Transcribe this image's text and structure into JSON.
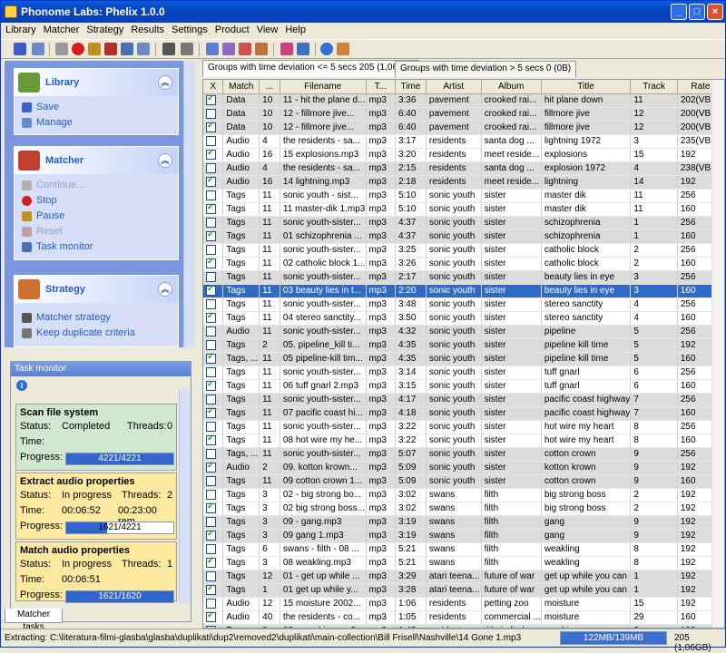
{
  "window": {
    "title": "Phonome Labs: Phelix 1.0.0",
    "minimize": "_",
    "maximize": "□",
    "close": "×"
  },
  "menu": [
    "Library",
    "Matcher",
    "Strategy",
    "Results",
    "Settings",
    "Product",
    "View",
    "Help"
  ],
  "sidebar": {
    "library": {
      "title": "Library",
      "items": [
        "Save",
        "Manage"
      ]
    },
    "matcher": {
      "title": "Matcher",
      "items": [
        "Continue...",
        "Stop",
        "Pause",
        "Reset",
        "Task monitor"
      ]
    },
    "strategy": {
      "title": "Strategy",
      "items": [
        "Matcher strategy",
        "Keep duplicate criteria"
      ]
    }
  },
  "taskmonitor": {
    "title": "Task monitor",
    "tasks": [
      {
        "name": "Scan file system",
        "status_label": "Status:",
        "status": "Completed",
        "threads_label": "Threads:",
        "threads": "0",
        "time_label": "Time:",
        "time": "",
        "eta": "",
        "progress_label": "Progress:",
        "progress": "4221/4221",
        "fraction": 1.0,
        "color": "#cfe8cf"
      },
      {
        "name": "Extract audio properties",
        "status_label": "Status:",
        "status": "In progress",
        "threads_label": "Threads:",
        "threads": "2",
        "time_label": "Time:",
        "time": "00:06:52",
        "eta": "00:23:00 rem",
        "progress_label": "Progress:",
        "progress": "1621/4221",
        "fraction": 0.38,
        "color": "#fde9a0"
      },
      {
        "name": "Match audio properties",
        "status_label": "Status:",
        "status": "In progress",
        "threads_label": "Threads:",
        "threads": "1",
        "time_label": "Time:",
        "time": "00:06:51",
        "eta": "",
        "progress_label": "Progress:",
        "progress": "1621/1620",
        "fraction": 1.0,
        "color": "#fde9a0"
      }
    ],
    "tab": "Matcher tasks"
  },
  "tabs": [
    "Groups with time deviation <= 5 secs 205 (1,06GB)",
    "Groups with time deviation > 5 secs  0 (0B)"
  ],
  "columns": [
    "X",
    "Match",
    "...",
    "Filename",
    "T...",
    "Time",
    "Artist",
    "Album",
    "Title",
    "Track",
    "Rate"
  ],
  "rows": [
    [
      1,
      "Data",
      "10",
      "11 - hit the plane d...",
      "mp3",
      "3:36",
      "pavement",
      "crooked rai...",
      "hit plane down",
      "11",
      "202(VBR)",
      "g"
    ],
    [
      0,
      "Data",
      "10",
      "12 - fillmore jive...",
      "mp3",
      "6:40",
      "pavement",
      "crooked rai...",
      "fillmore jive",
      "12",
      "200(VBR)",
      "g"
    ],
    [
      1,
      "Data",
      "10",
      "12 - fillmore jive...",
      "mp3",
      "6:40",
      "pavement",
      "crooked rai...",
      "fillmore jive",
      "12",
      "200(VBR)",
      "g"
    ],
    [
      0,
      "Audio",
      "4",
      "the residents - sa...",
      "mp3",
      "3:17",
      "residents",
      "santa dog ...",
      "lightning 1972",
      "3",
      "235(VBR)",
      "w"
    ],
    [
      1,
      "Audio",
      "16",
      "15 explosions.mp3",
      "mp3",
      "3:20",
      "residents",
      "meet reside...",
      "explosions",
      "15",
      "192",
      "w"
    ],
    [
      0,
      "Audio",
      "4",
      "the residents - sa...",
      "mp3",
      "2:15",
      "residents",
      "santa dog ...",
      "explosion 1972",
      "4",
      "238(VBR)",
      "g"
    ],
    [
      1,
      "Audio",
      "16",
      "14 lightning.mp3",
      "mp3",
      "2:18",
      "residents",
      "meet reside...",
      "lightning",
      "14",
      "192",
      "g"
    ],
    [
      0,
      "Tags",
      "11",
      "sonic youth - sist...",
      "mp3",
      "5:10",
      "sonic youth",
      "sister",
      "master dik",
      "11",
      "256",
      "w"
    ],
    [
      1,
      "Tags",
      "11",
      "11 master-dik 1.mp3",
      "mp3",
      "5:10",
      "sonic youth",
      "sister",
      "master dik",
      "11",
      "160",
      "w"
    ],
    [
      0,
      "Tags",
      "11",
      "sonic youth-sister...",
      "mp3",
      "4:37",
      "sonic youth",
      "sister",
      "schizophrenia",
      "1",
      "256",
      "g"
    ],
    [
      1,
      "Tags",
      "11",
      "01 schizophrenia ...",
      "mp3",
      "4:37",
      "sonic youth",
      "sister",
      "schizophrenia",
      "1",
      "160",
      "g"
    ],
    [
      0,
      "Tags",
      "11",
      "sonic youth-sister...",
      "mp3",
      "3:25",
      "sonic youth",
      "sister",
      "catholic block",
      "2",
      "256",
      "w"
    ],
    [
      1,
      "Tags",
      "11",
      "02 catholic block 1...",
      "mp3",
      "3:26",
      "sonic youth",
      "sister",
      "catholic block",
      "2",
      "160",
      "w"
    ],
    [
      0,
      "Tags",
      "11",
      "sonic youth-sister...",
      "mp3",
      "2:17",
      "sonic youth",
      "sister",
      "beauty lies in eye",
      "3",
      "256",
      "g"
    ],
    [
      1,
      "Tags",
      "11",
      "03 beauty lies in t...",
      "mp3",
      "2:20",
      "sonic youth",
      "sister",
      "beauty lies in eye",
      "3",
      "160",
      "sel"
    ],
    [
      0,
      "Tags",
      "11",
      "sonic youth-sister...",
      "mp3",
      "3:48",
      "sonic youth",
      "sister",
      "stereo sanctity",
      "4",
      "256",
      "w"
    ],
    [
      1,
      "Tags",
      "11",
      "04 stereo sanctity...",
      "mp3",
      "3:50",
      "sonic youth",
      "sister",
      "stereo sanctity",
      "4",
      "160",
      "w"
    ],
    [
      0,
      "Audio",
      "11",
      "sonic youth-sister...",
      "mp3",
      "4:32",
      "sonic youth",
      "sister",
      "pipeline",
      "5",
      "256",
      "g"
    ],
    [
      0,
      "Tags",
      "2",
      "05. pipeline_kill ti...",
      "mp3",
      "4:35",
      "sonic youth",
      "sister",
      "pipeline kill time",
      "5",
      "192",
      "g"
    ],
    [
      1,
      "Tags, ...",
      "11",
      "05 pipeline-kill tim...",
      "mp3",
      "4:35",
      "sonic youth",
      "sister",
      "pipeline kill time",
      "5",
      "160",
      "g"
    ],
    [
      0,
      "Tags",
      "11",
      "sonic youth-sister...",
      "mp3",
      "3:14",
      "sonic youth",
      "sister",
      "tuff gnarl",
      "6",
      "256",
      "w"
    ],
    [
      1,
      "Tags",
      "11",
      "06 tuff gnarl 2.mp3",
      "mp3",
      "3:15",
      "sonic youth",
      "sister",
      "tuff gnarl",
      "6",
      "160",
      "w"
    ],
    [
      0,
      "Tags",
      "11",
      "sonic youth-sister...",
      "mp3",
      "4:17",
      "sonic youth",
      "sister",
      "pacific coast highway",
      "7",
      "256",
      "g"
    ],
    [
      1,
      "Tags",
      "11",
      "07 pacific coast hi...",
      "mp3",
      "4:18",
      "sonic youth",
      "sister",
      "pacific coast highway",
      "7",
      "160",
      "g"
    ],
    [
      0,
      "Tags",
      "11",
      "sonic youth-sister...",
      "mp3",
      "3:22",
      "sonic youth",
      "sister",
      "hot wire my heart",
      "8",
      "256",
      "w"
    ],
    [
      1,
      "Tags",
      "11",
      "08 hot wire my he...",
      "mp3",
      "3:22",
      "sonic youth",
      "sister",
      "hot wire my heart",
      "8",
      "160",
      "w"
    ],
    [
      0,
      "Tags, ...",
      "11",
      "sonic youth-sister...",
      "mp3",
      "5:07",
      "sonic youth",
      "sister",
      "cotton crown",
      "9",
      "256",
      "g"
    ],
    [
      1,
      "Audio",
      "2",
      "09. kotton krown...",
      "mp3",
      "5:09",
      "sonic youth",
      "sister",
      "kotton krown",
      "9",
      "192",
      "g"
    ],
    [
      0,
      "Tags",
      "11",
      "09 cotton crown 1...",
      "mp3",
      "5:09",
      "sonic youth",
      "sister",
      "cotton crown",
      "9",
      "160",
      "g"
    ],
    [
      0,
      "Tags",
      "3",
      "02 - big strong bo...",
      "mp3",
      "3:02",
      "swans",
      "filth",
      "big strong boss",
      "2",
      "192",
      "w"
    ],
    [
      1,
      "Tags",
      "3",
      "02 big strong boss...",
      "mp3",
      "3:02",
      "swans",
      "filth",
      "big strong boss",
      "2",
      "192",
      "w"
    ],
    [
      0,
      "Tags",
      "3",
      "09 - gang.mp3",
      "mp3",
      "3:19",
      "swans",
      "filth",
      "gang",
      "9",
      "192",
      "g"
    ],
    [
      1,
      "Tags",
      "3",
      "09 gang 1.mp3",
      "mp3",
      "3:19",
      "swans",
      "filth",
      "gang",
      "9",
      "192",
      "g"
    ],
    [
      0,
      "Tags",
      "6",
      "swans - filth - 08 ...",
      "mp3",
      "5:21",
      "swans",
      "filth",
      "weakling",
      "8",
      "192",
      "w"
    ],
    [
      1,
      "Tags",
      "3",
      "08 weakling.mp3",
      "mp3",
      "5:21",
      "swans",
      "filth",
      "weakling",
      "8",
      "192",
      "w"
    ],
    [
      0,
      "Tags",
      "12",
      "01 - get up while ...",
      "mp3",
      "3:29",
      "atari teena...",
      "future of war",
      "get up while you can",
      "1",
      "192",
      "g"
    ],
    [
      1,
      "Tags",
      "1",
      "01 get up while y...",
      "mp3",
      "3:28",
      "atari teena...",
      "future of war",
      "get up while you can",
      "1",
      "192",
      "g"
    ],
    [
      0,
      "Audio",
      "12",
      "15 moisture 2002...",
      "mp3",
      "1:06",
      "residents",
      "petting zoo",
      "moisture",
      "15",
      "192",
      "w"
    ],
    [
      1,
      "Audio",
      "40",
      "the residents - co...",
      "mp3",
      "1:05",
      "residents",
      "commercial ...",
      "moisture",
      "29",
      "160",
      "w"
    ],
    [
      0,
      "Tags",
      "9",
      "03 - crashing.mp3",
      "mp3",
      "1:43",
      "residents",
      "title in limbo",
      "crashing",
      "3",
      "192",
      "g"
    ]
  ],
  "status": {
    "text": "Extracting: C:\\literatura-filmi-glasba\\glasba\\duplikati\\dup2\\removed2\\duplikati\\main-collection\\Bill Frisell\\Nashville\\14 Gone 1.mp3",
    "memory": "122MB/139MB",
    "summary": "205 (1,06GB)"
  }
}
